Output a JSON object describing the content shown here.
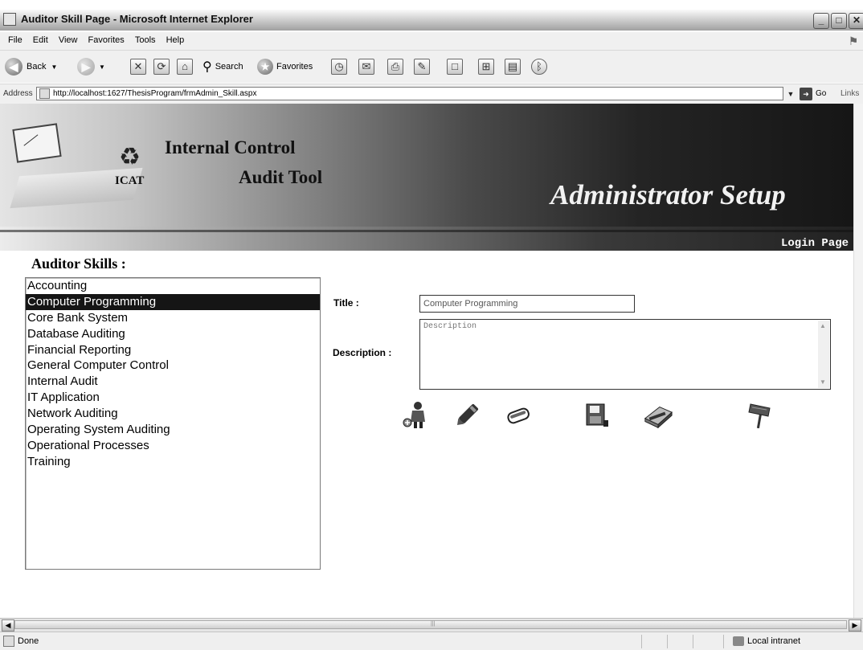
{
  "window": {
    "title": "Auditor Skill Page - Microsoft Internet Explorer",
    "controls": {
      "minimize": "_",
      "maximize": "□",
      "close": "✕"
    }
  },
  "menu": [
    "File",
    "Edit",
    "View",
    "Favorites",
    "Tools",
    "Help"
  ],
  "toolbar": {
    "back": "Back",
    "search": "Search",
    "favorites": "Favorites"
  },
  "address": {
    "label": "Address",
    "url": "http://localhost:1627/ThesisProgram/frmAdmin_Skill.aspx",
    "go": "Go",
    "links": "Links"
  },
  "banner": {
    "line1": "Internal Control",
    "line2": "Audit Tool",
    "brand": "ICAT",
    "section": "Administrator Setup",
    "login_link": "Login Page"
  },
  "skills": {
    "heading": "Auditor Skills :",
    "items": [
      "Accounting",
      "Computer Programming",
      "Core Bank System",
      "Database Auditing",
      "Financial Reporting",
      "General Computer Control",
      "Internal Audit",
      "IT Application",
      "Network Auditing",
      "Operating System Auditing",
      "Operational Processes",
      "Training"
    ],
    "selected": "Computer Programming"
  },
  "form": {
    "title_label": "Title :",
    "title_value": "Computer Programming",
    "description_label": "Description :",
    "description_placeholder": "Description"
  },
  "actions": [
    {
      "icon": "add-person-icon"
    },
    {
      "icon": "pencil-icon"
    },
    {
      "icon": "eraser-icon"
    },
    {
      "icon": "save-disk-icon"
    },
    {
      "icon": "cancel-icon"
    },
    {
      "icon": "signpost-icon"
    }
  ],
  "status": {
    "text": "Done",
    "zone": "Local intranet"
  }
}
